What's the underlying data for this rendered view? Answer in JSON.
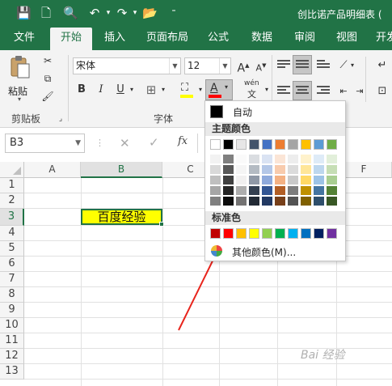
{
  "title": "创比诺产品明细表 (",
  "tabs": [
    {
      "label": "文件",
      "active": false
    },
    {
      "label": "开始",
      "active": true
    },
    {
      "label": "插入",
      "active": false
    },
    {
      "label": "页面布局",
      "active": false
    },
    {
      "label": "公式",
      "active": false
    },
    {
      "label": "数据",
      "active": false
    },
    {
      "label": "审阅",
      "active": false
    },
    {
      "label": "视图",
      "active": false
    },
    {
      "label": "开发",
      "active": false
    }
  ],
  "ribbon": {
    "paste_label": "粘贴",
    "clipboard_group": "剪贴板",
    "font_group": "字体",
    "font_name": "宋体",
    "font_size": "12",
    "bold": "B",
    "italic": "I",
    "underline": "U",
    "grow_font": "A",
    "shrink_font": "A",
    "font_color_glyph": "A",
    "phonetic": "wén",
    "phonetic_glyph": "文",
    "font_color_accent": "#ff0000",
    "fill_color_accent": "#ffff00"
  },
  "formula_bar": {
    "name_box": "B3",
    "cancel": "✕",
    "enter": "✓",
    "fx": "fx"
  },
  "sheet": {
    "columns": [
      "A",
      "B",
      "C",
      "F"
    ],
    "rows": [
      "1",
      "2",
      "3",
      "4",
      "5",
      "6",
      "7",
      "8",
      "9",
      "10",
      "11",
      "12",
      "13"
    ],
    "selected_cell": "B3",
    "cell_b3_value": "百度经验",
    "cell_b3_fill": "#ffff00"
  },
  "font_color_menu": {
    "auto_label": "自动",
    "theme_header": "主题颜色",
    "standard_header": "标准色",
    "more_colors": "其他颜色(M)...",
    "theme_colors": [
      "#ffffff",
      "#000000",
      "#e7e6e6",
      "#44546a",
      "#4472c4",
      "#ed7d31",
      "#a5a5a5",
      "#ffc000",
      "#5b9bd5",
      "#70ad47"
    ],
    "standard_colors": [
      "#c00000",
      "#ff0000",
      "#ffc000",
      "#ffff00",
      "#92d050",
      "#00b050",
      "#00b0f0",
      "#0070c0",
      "#002060",
      "#7030a0"
    ]
  },
  "watermark": "Bai 经验"
}
